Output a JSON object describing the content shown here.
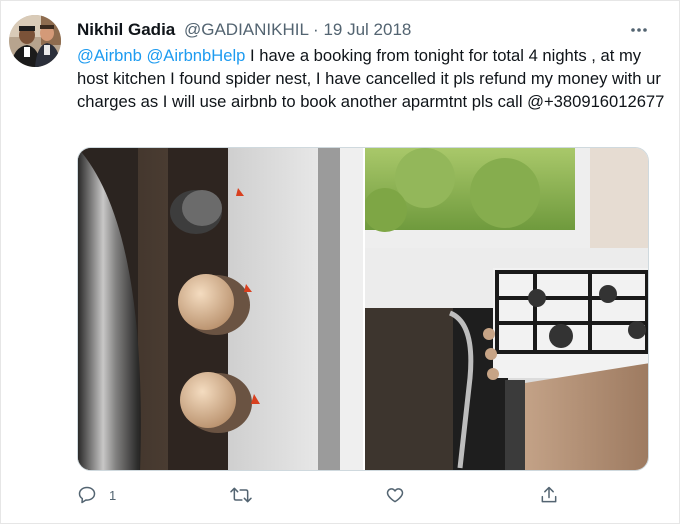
{
  "tweet": {
    "author_name": "Nikhil Gadia",
    "author_handle": "@GADIANIKHIL",
    "separator": "·",
    "date": "19 Jul 2018",
    "mention_1": "@Airbnb",
    "mention_2": "@AirbnbHelp",
    "body": " I have a booking from tonight for total 4 nights , at my host kitchen I found spider nest, I have cancelled it pls refund my money with ur charges as I will use airbnb to book another aparmtnt pls call @+380916012677",
    "reply_count": "1",
    "retweet_count": "",
    "like_count": ""
  },
  "icons": {
    "more": "more-horizontal-icon",
    "reply": "reply-icon",
    "retweet": "retweet-icon",
    "like": "heart-icon",
    "share": "share-icon"
  },
  "colors": {
    "link": "#1d9bf0",
    "secondary_text": "#536471",
    "primary_text": "#0f1419"
  }
}
